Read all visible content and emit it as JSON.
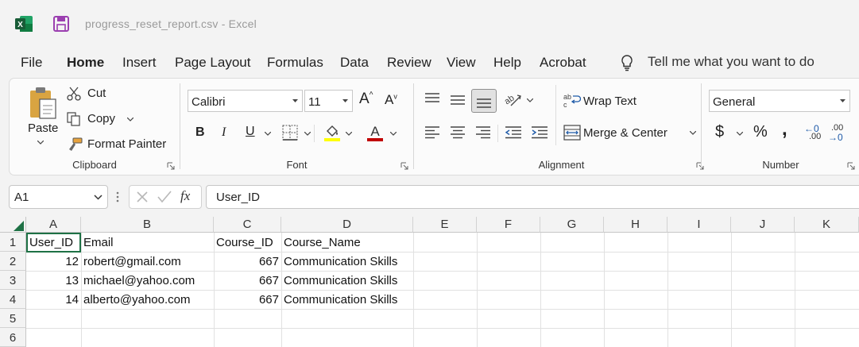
{
  "window": {
    "title": "progress_reset_report.csv  -  Excel"
  },
  "menu": {
    "items": [
      "File",
      "Home",
      "Insert",
      "Page Layout",
      "Formulas",
      "Data",
      "Review",
      "View",
      "Help",
      "Acrobat"
    ],
    "active": "Home",
    "tell_me": "Tell me what you want to do"
  },
  "ribbon": {
    "clipboard": {
      "label": "Clipboard",
      "paste": "Paste",
      "cut": "Cut",
      "copy": "Copy",
      "format_painter": "Format Painter"
    },
    "font": {
      "label": "Font",
      "name": "Calibri",
      "size": "11",
      "bold": "B",
      "italic": "I",
      "underline": "U"
    },
    "alignment": {
      "label": "Alignment",
      "wrap_text": "Wrap Text",
      "merge_center": "Merge & Center"
    },
    "number": {
      "label": "Number",
      "format": "General",
      "currency": "$",
      "percent": "%",
      "comma": ",",
      "inc_decimal": ".00",
      "dec_decimal": ".00"
    }
  },
  "formula_bar": {
    "name_box": "A1",
    "content": "User_ID",
    "fx": "fx"
  },
  "sheet": {
    "columns": [
      "A",
      "B",
      "C",
      "D",
      "E",
      "F",
      "G",
      "H",
      "I",
      "J",
      "K"
    ],
    "rows": [
      "1",
      "2",
      "3",
      "4",
      "5",
      "6"
    ],
    "header": [
      "User_ID",
      "Email",
      "Course_ID",
      "Course_Name"
    ],
    "data": [
      [
        "12",
        "robert@gmail.com",
        "667",
        "Communication Skills"
      ],
      [
        "13",
        "michael@yahoo.com",
        "667",
        "Communication Skills"
      ],
      [
        "14",
        "alberto@yahoo.com",
        "667",
        "Communication Skills"
      ]
    ]
  },
  "colors": {
    "excel_green": "#1e7145",
    "font_color_red": "#c00000",
    "highlight_yellow": "#ffff00"
  }
}
